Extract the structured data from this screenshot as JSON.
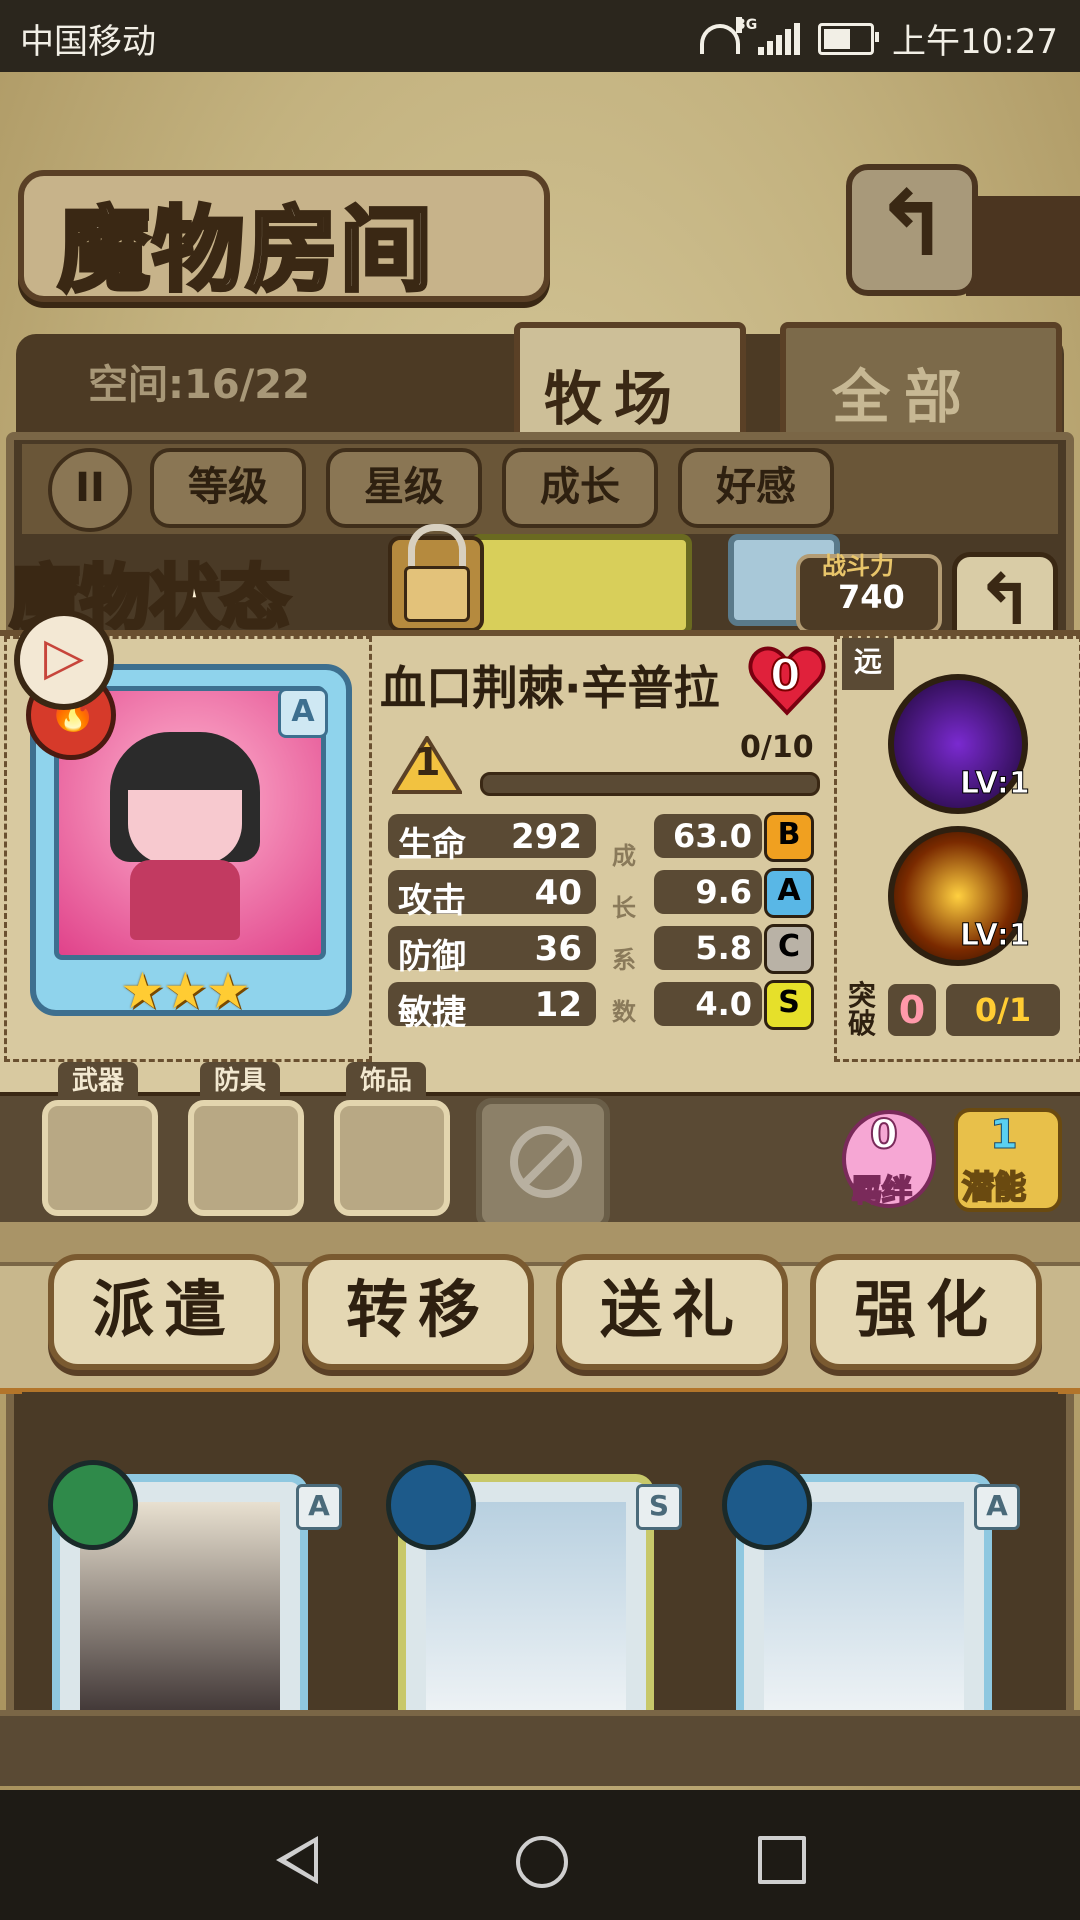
{
  "status_bar": {
    "carrier": "中国移动",
    "network": "3G",
    "time": "上午10:27"
  },
  "header": {
    "title": "魔物房间",
    "space": "空间:16/22",
    "tabs": [
      "牧场",
      "全部"
    ],
    "active_tab": "牧场"
  },
  "filters": {
    "pause_icon": "pause-icon",
    "buttons": [
      "等级",
      "星级",
      "成长",
      "好感"
    ]
  },
  "monster_status": {
    "title": "魔物状态",
    "power_label": "战斗力",
    "power_value": "740",
    "name": "血口荆棘·辛普拉",
    "heart_value": "0",
    "grade": "A",
    "stars": "★★★",
    "level": "1",
    "exp": "0/10",
    "stats": [
      {
        "label": "生命",
        "value": "292",
        "growth": "63.0",
        "rank": "B"
      },
      {
        "label": "攻击",
        "value": "40",
        "growth": "9.6",
        "rank": "A"
      },
      {
        "label": "防御",
        "value": "36",
        "growth": "5.8",
        "rank": "C"
      },
      {
        "label": "敏捷",
        "value": "12",
        "growth": "4.0",
        "rank": "S"
      }
    ],
    "growth_vertical": [
      "成",
      "长",
      "系",
      "数"
    ],
    "range_tag": "远",
    "skills": [
      {
        "level": "LV:1",
        "icon": "dark-shadow-skill-icon"
      },
      {
        "level": "LV:1",
        "icon": "flame-sword-skill-icon"
      }
    ],
    "breakthrough": {
      "label": "突破",
      "value": "0",
      "ratio": "0/1"
    }
  },
  "equipment": {
    "slots": [
      "武器",
      "防具",
      "饰品"
    ]
  },
  "bond": {
    "value": "0",
    "label": "羁绊"
  },
  "potential": {
    "value": "1",
    "label": "潜能"
  },
  "actions": [
    "派遣",
    "转移",
    "送礼",
    "强化"
  ],
  "grid_cards": [
    {
      "grade": "A"
    },
    {
      "grade": "S"
    },
    {
      "grade": "A"
    }
  ],
  "colors": {
    "rank_B": "#f0a020",
    "rank_A": "#59b7e6",
    "rank_C": "#b9b2a6",
    "rank_S": "#e6e02a"
  }
}
